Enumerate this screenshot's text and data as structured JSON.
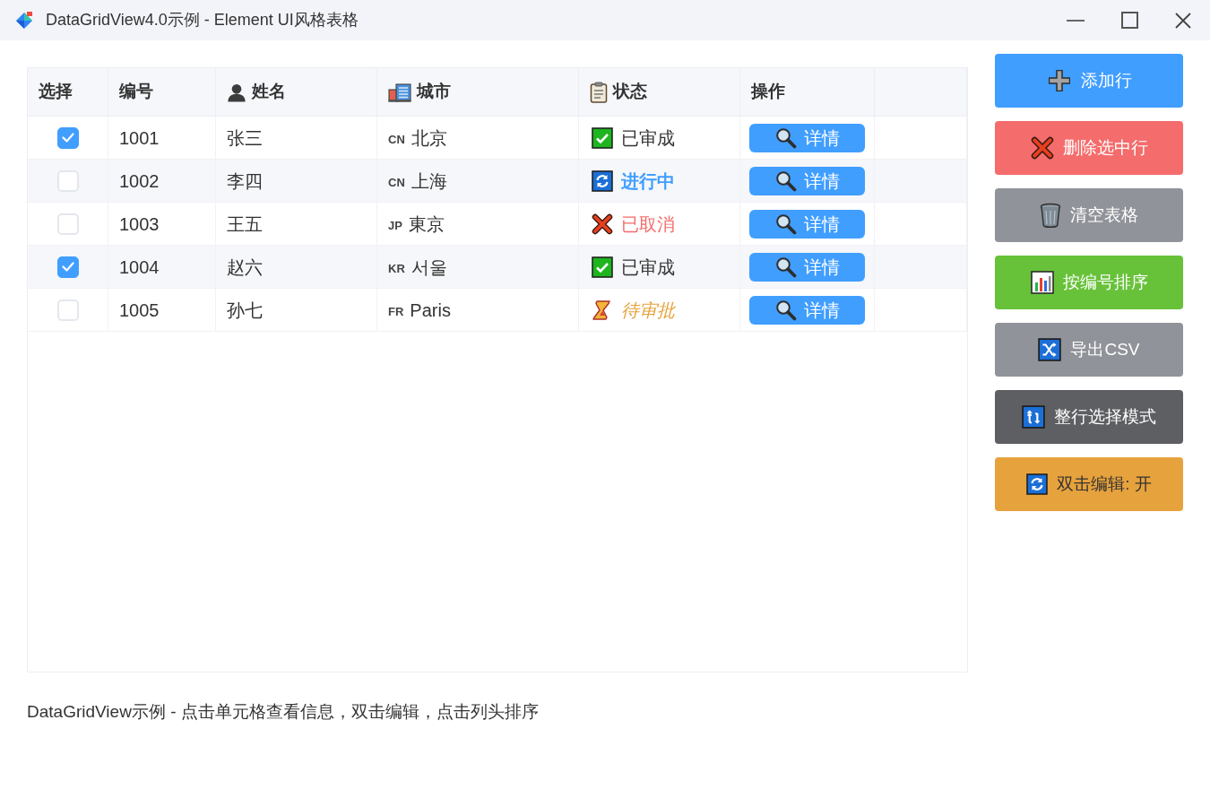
{
  "window": {
    "title": "DataGridView4.0示例 - Element UI风格表格"
  },
  "table": {
    "columns": [
      {
        "kind": "select",
        "label": "选择"
      },
      {
        "kind": "id",
        "label": "编号"
      },
      {
        "kind": "name",
        "label": "姓名"
      },
      {
        "kind": "city",
        "label": "城市"
      },
      {
        "kind": "status",
        "label": "状态"
      },
      {
        "kind": "action",
        "label": "操作"
      }
    ],
    "rows": [
      {
        "checked": true,
        "id": "1001",
        "name": "张三",
        "city": {
          "code": "CN",
          "name": "北京"
        },
        "status": {
          "kind": "approved",
          "label": "已审成"
        },
        "action": "详情"
      },
      {
        "checked": false,
        "id": "1002",
        "name": "李四",
        "city": {
          "code": "CN",
          "name": "上海"
        },
        "status": {
          "kind": "in_progress",
          "label": "进行中"
        },
        "action": "详情"
      },
      {
        "checked": false,
        "id": "1003",
        "name": "王五",
        "city": {
          "code": "JP",
          "name": "東京"
        },
        "status": {
          "kind": "cancelled",
          "label": "已取消"
        },
        "action": "详情"
      },
      {
        "checked": true,
        "id": "1004",
        "name": "赵六",
        "city": {
          "code": "KR",
          "name": "서울"
        },
        "status": {
          "kind": "approved",
          "label": "已审成"
        },
        "action": "详情"
      },
      {
        "checked": false,
        "id": "1005",
        "name": "孙七",
        "city": {
          "code": "FR",
          "name": "Paris"
        },
        "status": {
          "kind": "pending",
          "label": "待审批"
        },
        "action": "详情"
      }
    ]
  },
  "buttons": [
    {
      "kind": "add",
      "label": "添加行"
    },
    {
      "kind": "delete",
      "label": "删除选中行"
    },
    {
      "kind": "clear",
      "label": "清空表格"
    },
    {
      "kind": "sort",
      "label": "按编号排序"
    },
    {
      "kind": "export",
      "label": "导出CSV"
    },
    {
      "kind": "row_mode",
      "label": "整行选择模式"
    },
    {
      "kind": "edit_toggle",
      "label": "双击编辑: 开"
    }
  ],
  "status_bar": "DataGridView示例 - 点击单元格查看信息，双击编辑，点击列头排序"
}
